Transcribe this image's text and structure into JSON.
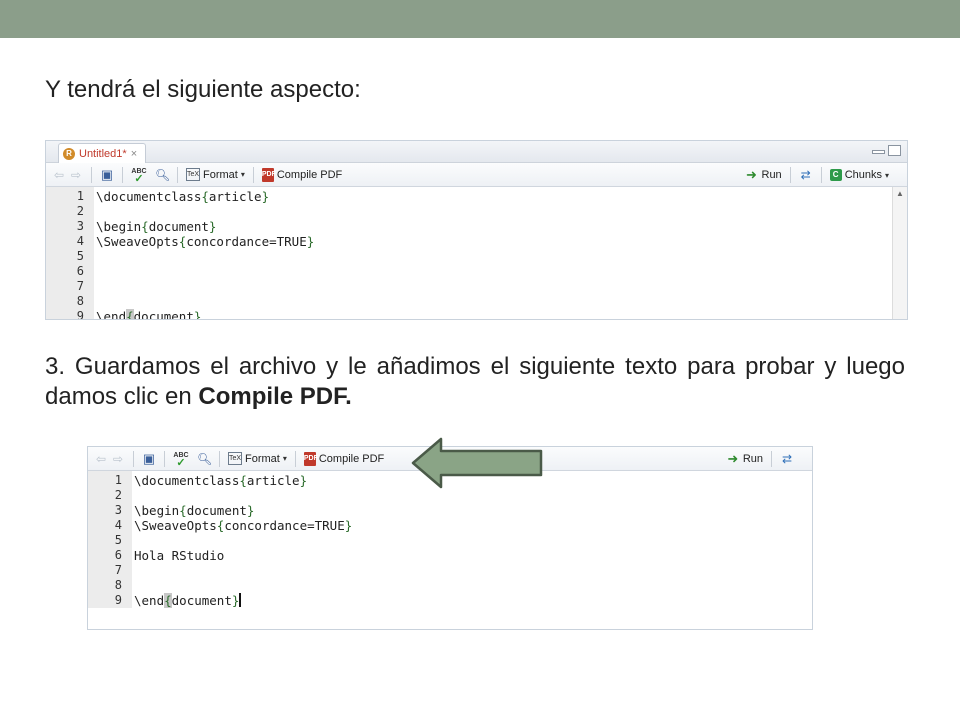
{
  "slide": {
    "heading": "Y tendrá el siguiente aspecto:",
    "paragraph_prefix": "3. Guardamos el archivo y le añadimos el siguiente texto para probar y luego damos clic en ",
    "paragraph_bold": "Compile PDF."
  },
  "editor1": {
    "tab_label": "Untitled1*",
    "toolbar": {
      "abc_label": "ABC",
      "format_label": "Format",
      "compile_label": "Compile PDF",
      "run_label": "Run",
      "chunks_label": "Chunks"
    },
    "line_numbers": [
      "1",
      "2",
      "3",
      "4",
      "5",
      "6",
      "7",
      "8",
      "9"
    ],
    "lines": [
      {
        "cmd": "\\documentclass",
        "open": "{",
        "arg": "article",
        "close": "}"
      },
      {
        "cmd": "",
        "open": "",
        "arg": "",
        "close": ""
      },
      {
        "cmd": "\\begin",
        "open": "{",
        "arg": "document",
        "close": "}"
      },
      {
        "cmd": "\\SweaveOpts",
        "open": "{",
        "arg": "concordance=TRUE",
        "close": "}"
      },
      {
        "cmd": "",
        "open": "",
        "arg": "",
        "close": ""
      },
      {
        "cmd": "",
        "open": "",
        "arg": "",
        "close": ""
      },
      {
        "cmd": "",
        "open": "",
        "arg": "",
        "close": ""
      },
      {
        "cmd": "",
        "open": "",
        "arg": "",
        "close": ""
      },
      {
        "cmd": "\\end",
        "open": "{",
        "arg": "document",
        "close": "}"
      }
    ]
  },
  "editor2": {
    "toolbar": {
      "abc_label": "ABC",
      "format_label": "Format",
      "compile_label": "Compile PDF",
      "run_label": "Run"
    },
    "line_numbers": [
      "1",
      "2",
      "3",
      "4",
      "5",
      "6",
      "7",
      "8",
      "9"
    ],
    "lines": [
      {
        "cmd": "\\documentclass",
        "open": "{",
        "arg": "article",
        "close": "}"
      },
      {
        "cmd": "",
        "open": "",
        "arg": "",
        "close": ""
      },
      {
        "cmd": "\\begin",
        "open": "{",
        "arg": "document",
        "close": "}"
      },
      {
        "cmd": "\\SweaveOpts",
        "open": "{",
        "arg": "concordance=TRUE",
        "close": "}"
      },
      {
        "cmd": "",
        "open": "",
        "arg": "",
        "close": ""
      },
      {
        "cmd": "Hola RStudio",
        "open": "",
        "arg": "",
        "close": ""
      },
      {
        "cmd": "",
        "open": "",
        "arg": "",
        "close": ""
      },
      {
        "cmd": "",
        "open": "",
        "arg": "",
        "close": ""
      },
      {
        "cmd": "\\end",
        "open": "{",
        "arg": "document",
        "close": "}"
      }
    ]
  },
  "colors": {
    "top_bar": "#8b9e8a",
    "arrow_fill": "#8aa486",
    "arrow_stroke": "#4a5a48"
  }
}
